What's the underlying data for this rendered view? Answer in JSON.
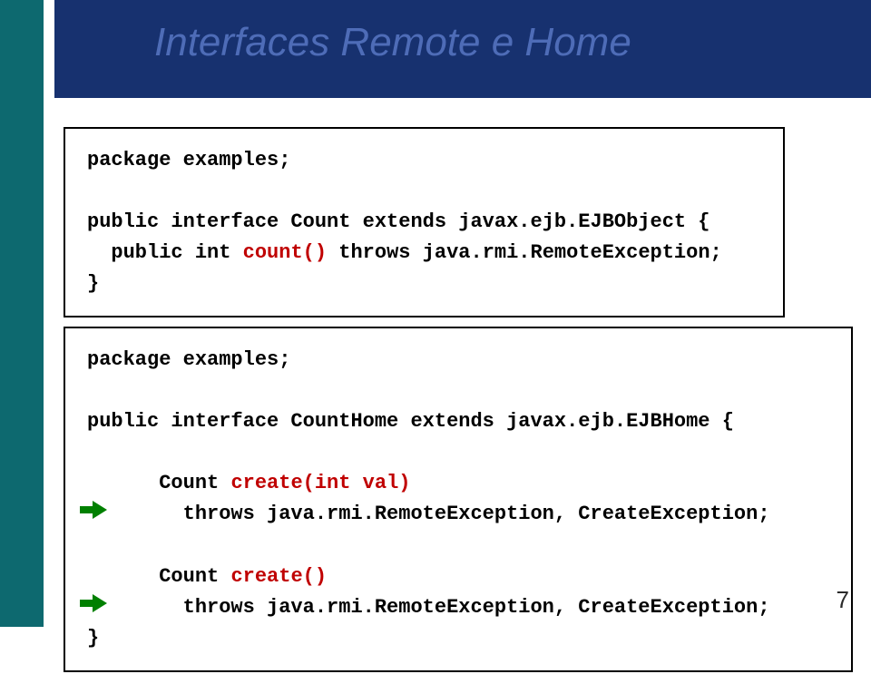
{
  "title": "Interfaces Remote e Home",
  "page_number": "7",
  "box1": {
    "l1a": "package examples;",
    "l2a": "public interface Count extends javax.ejb.EJBObject {",
    "l3a": "  public int ",
    "l3b": "count()",
    "l3c": " throws java.rmi.RemoteException;",
    "l4a": "}"
  },
  "box2": {
    "l1a": "package examples;",
    "l2a": "public interface CountHome extends javax.ejb.EJBHome {",
    "l3a": "  Count ",
    "l3b": "create(int val)",
    "l4a": "        throws java.rmi.RemoteException, CreateException;",
    "l5a": "  Count ",
    "l5b": "create()",
    "l6a": "        throws java.rmi.RemoteException, CreateException;",
    "l7a": "}"
  }
}
